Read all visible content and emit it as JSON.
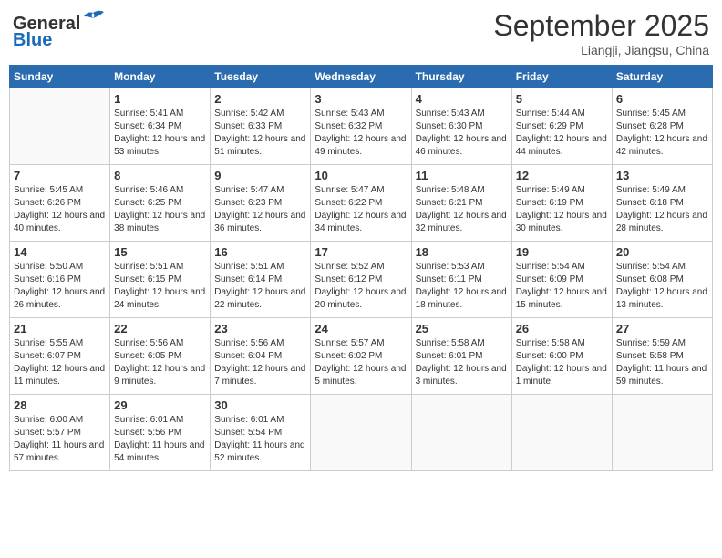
{
  "header": {
    "logo_line1": "General",
    "logo_line2": "Blue",
    "month": "September 2025",
    "location": "Liangji, Jiangsu, China"
  },
  "weekdays": [
    "Sunday",
    "Monday",
    "Tuesday",
    "Wednesday",
    "Thursday",
    "Friday",
    "Saturday"
  ],
  "weeks": [
    [
      {
        "day": "",
        "info": ""
      },
      {
        "day": "1",
        "info": "Sunrise: 5:41 AM\nSunset: 6:34 PM\nDaylight: 12 hours\nand 53 minutes."
      },
      {
        "day": "2",
        "info": "Sunrise: 5:42 AM\nSunset: 6:33 PM\nDaylight: 12 hours\nand 51 minutes."
      },
      {
        "day": "3",
        "info": "Sunrise: 5:43 AM\nSunset: 6:32 PM\nDaylight: 12 hours\nand 49 minutes."
      },
      {
        "day": "4",
        "info": "Sunrise: 5:43 AM\nSunset: 6:30 PM\nDaylight: 12 hours\nand 46 minutes."
      },
      {
        "day": "5",
        "info": "Sunrise: 5:44 AM\nSunset: 6:29 PM\nDaylight: 12 hours\nand 44 minutes."
      },
      {
        "day": "6",
        "info": "Sunrise: 5:45 AM\nSunset: 6:28 PM\nDaylight: 12 hours\nand 42 minutes."
      }
    ],
    [
      {
        "day": "7",
        "info": "Sunrise: 5:45 AM\nSunset: 6:26 PM\nDaylight: 12 hours\nand 40 minutes."
      },
      {
        "day": "8",
        "info": "Sunrise: 5:46 AM\nSunset: 6:25 PM\nDaylight: 12 hours\nand 38 minutes."
      },
      {
        "day": "9",
        "info": "Sunrise: 5:47 AM\nSunset: 6:23 PM\nDaylight: 12 hours\nand 36 minutes."
      },
      {
        "day": "10",
        "info": "Sunrise: 5:47 AM\nSunset: 6:22 PM\nDaylight: 12 hours\nand 34 minutes."
      },
      {
        "day": "11",
        "info": "Sunrise: 5:48 AM\nSunset: 6:21 PM\nDaylight: 12 hours\nand 32 minutes."
      },
      {
        "day": "12",
        "info": "Sunrise: 5:49 AM\nSunset: 6:19 PM\nDaylight: 12 hours\nand 30 minutes."
      },
      {
        "day": "13",
        "info": "Sunrise: 5:49 AM\nSunset: 6:18 PM\nDaylight: 12 hours\nand 28 minutes."
      }
    ],
    [
      {
        "day": "14",
        "info": "Sunrise: 5:50 AM\nSunset: 6:16 PM\nDaylight: 12 hours\nand 26 minutes."
      },
      {
        "day": "15",
        "info": "Sunrise: 5:51 AM\nSunset: 6:15 PM\nDaylight: 12 hours\nand 24 minutes."
      },
      {
        "day": "16",
        "info": "Sunrise: 5:51 AM\nSunset: 6:14 PM\nDaylight: 12 hours\nand 22 minutes."
      },
      {
        "day": "17",
        "info": "Sunrise: 5:52 AM\nSunset: 6:12 PM\nDaylight: 12 hours\nand 20 minutes."
      },
      {
        "day": "18",
        "info": "Sunrise: 5:53 AM\nSunset: 6:11 PM\nDaylight: 12 hours\nand 18 minutes."
      },
      {
        "day": "19",
        "info": "Sunrise: 5:54 AM\nSunset: 6:09 PM\nDaylight: 12 hours\nand 15 minutes."
      },
      {
        "day": "20",
        "info": "Sunrise: 5:54 AM\nSunset: 6:08 PM\nDaylight: 12 hours\nand 13 minutes."
      }
    ],
    [
      {
        "day": "21",
        "info": "Sunrise: 5:55 AM\nSunset: 6:07 PM\nDaylight: 12 hours\nand 11 minutes."
      },
      {
        "day": "22",
        "info": "Sunrise: 5:56 AM\nSunset: 6:05 PM\nDaylight: 12 hours\nand 9 minutes."
      },
      {
        "day": "23",
        "info": "Sunrise: 5:56 AM\nSunset: 6:04 PM\nDaylight: 12 hours\nand 7 minutes."
      },
      {
        "day": "24",
        "info": "Sunrise: 5:57 AM\nSunset: 6:02 PM\nDaylight: 12 hours\nand 5 minutes."
      },
      {
        "day": "25",
        "info": "Sunrise: 5:58 AM\nSunset: 6:01 PM\nDaylight: 12 hours\nand 3 minutes."
      },
      {
        "day": "26",
        "info": "Sunrise: 5:58 AM\nSunset: 6:00 PM\nDaylight: 12 hours\nand 1 minute."
      },
      {
        "day": "27",
        "info": "Sunrise: 5:59 AM\nSunset: 5:58 PM\nDaylight: 11 hours\nand 59 minutes."
      }
    ],
    [
      {
        "day": "28",
        "info": "Sunrise: 6:00 AM\nSunset: 5:57 PM\nDaylight: 11 hours\nand 57 minutes."
      },
      {
        "day": "29",
        "info": "Sunrise: 6:01 AM\nSunset: 5:56 PM\nDaylight: 11 hours\nand 54 minutes."
      },
      {
        "day": "30",
        "info": "Sunrise: 6:01 AM\nSunset: 5:54 PM\nDaylight: 11 hours\nand 52 minutes."
      },
      {
        "day": "",
        "info": ""
      },
      {
        "day": "",
        "info": ""
      },
      {
        "day": "",
        "info": ""
      },
      {
        "day": "",
        "info": ""
      }
    ]
  ]
}
